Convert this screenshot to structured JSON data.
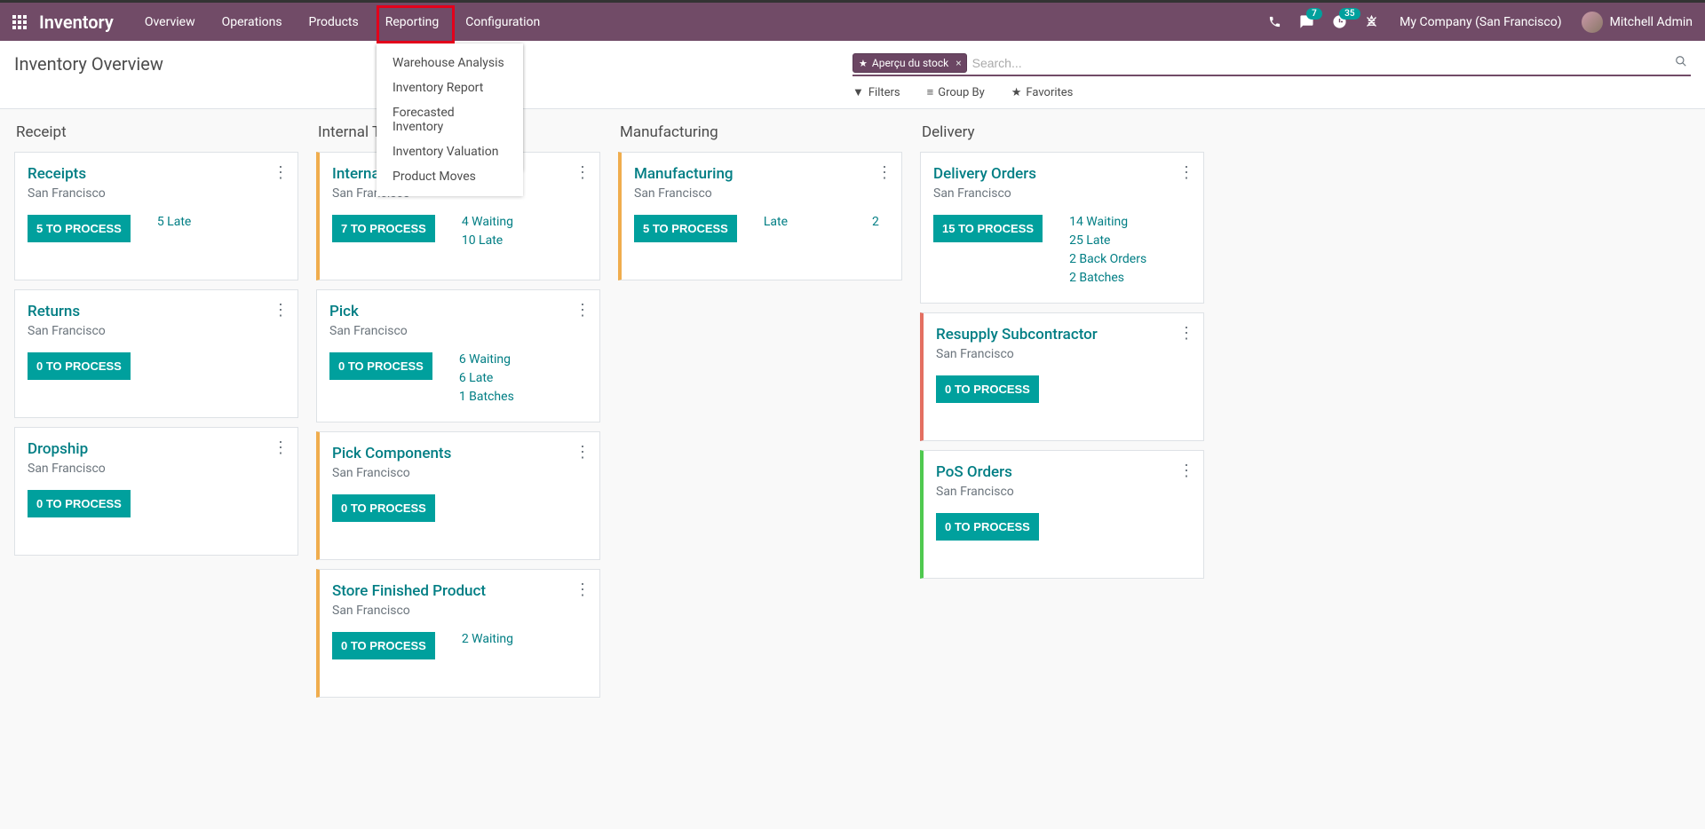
{
  "navbar": {
    "brand": "Inventory",
    "items": [
      "Overview",
      "Operations",
      "Products",
      "Reporting",
      "Configuration"
    ],
    "messages_badge": "7",
    "activities_badge": "35",
    "company": "My Company (San Francisco)",
    "user": "Mitchell Admin"
  },
  "dropdown": {
    "items": [
      "Warehouse Analysis",
      "Inventory Report",
      "Forecasted Inventory",
      "Inventory Valuation",
      "Product Moves"
    ]
  },
  "control_panel": {
    "title": "Inventory Overview",
    "search_tag": "Aperçu du stock",
    "search_placeholder": "Search...",
    "filters": "Filters",
    "group_by": "Group By",
    "favorites": "Favorites"
  },
  "columns": [
    {
      "title": "Receipt",
      "cards": [
        {
          "title": "Receipts",
          "sub": "San Francisco",
          "btn": "5 TO PROCESS",
          "stats": [
            "5 Late"
          ],
          "accent": ""
        },
        {
          "title": "Returns",
          "sub": "San Francisco",
          "btn": "0 TO PROCESS",
          "stats": [],
          "accent": ""
        },
        {
          "title": "Dropship",
          "sub": "San Francisco",
          "btn": "0 TO PROCESS",
          "stats": [],
          "accent": ""
        }
      ]
    },
    {
      "title": "Internal Transfer",
      "cards": [
        {
          "title": "Internal Transfers",
          "sub": "San Francisco",
          "btn": "7 TO PROCESS",
          "stats": [
            "4 Waiting",
            "10 Late"
          ],
          "accent": "orange"
        },
        {
          "title": "Pick",
          "sub": "San Francisco",
          "btn": "0 TO PROCESS",
          "stats": [
            "6 Waiting",
            "6 Late",
            "1 Batches"
          ],
          "accent": ""
        },
        {
          "title": "Pick Components",
          "sub": "San Francisco",
          "btn": "0 TO PROCESS",
          "stats": [],
          "accent": "orange"
        },
        {
          "title": "Store Finished Product",
          "sub": "San Francisco",
          "btn": "0 TO PROCESS",
          "stats": [
            "2 Waiting"
          ],
          "accent": "orange"
        }
      ]
    },
    {
      "title": "Manufacturing",
      "cards": [
        {
          "title": "Manufacturing",
          "sub": "San Francisco",
          "btn": "5 TO PROCESS",
          "split_label": "Late",
          "split_val": "2",
          "accent": "orange"
        }
      ]
    },
    {
      "title": "Delivery",
      "cards": [
        {
          "title": "Delivery Orders",
          "sub": "San Francisco",
          "btn": "15 TO PROCESS",
          "stats": [
            "14 Waiting",
            "25 Late",
            "2 Back Orders",
            "2 Batches"
          ],
          "accent": ""
        },
        {
          "title": "Resupply Subcontractor",
          "sub": "San Francisco",
          "btn": "0 TO PROCESS",
          "stats": [],
          "accent": "red"
        },
        {
          "title": "PoS Orders",
          "sub": "San Francisco",
          "btn": "0 TO PROCESS",
          "stats": [],
          "accent": "green"
        }
      ]
    }
  ]
}
